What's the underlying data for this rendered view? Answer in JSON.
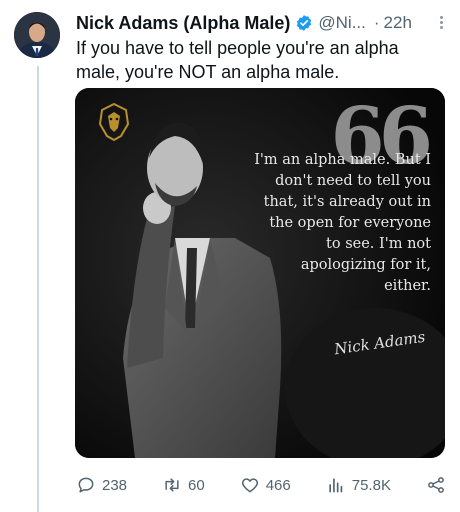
{
  "tweet": {
    "author_name": "Nick Adams (Alpha Male)",
    "handle": "@Ni...",
    "separator": "·",
    "time": "22h",
    "text": "If you have to tell people you're an alpha male, you're NOT an alpha male."
  },
  "media": {
    "quote_mark": "66",
    "quote_text": "I'm an alpha male. But I don't need to tell you that, it's already out in the open for everyone to see. I'm not apologizing for it, either.",
    "signature": "Nick Adams"
  },
  "actions": {
    "replies": "238",
    "retweets": "60",
    "likes": "466",
    "views": "75.8K"
  },
  "colors": {
    "verified": "#1d9bf0",
    "muted": "#536471",
    "thread_line": "#cfd9de"
  },
  "icons": [
    "verified-badge-icon",
    "more-icon",
    "reply-icon",
    "retweet-icon",
    "like-icon",
    "views-icon",
    "share-icon",
    "lion-logo-icon"
  ]
}
